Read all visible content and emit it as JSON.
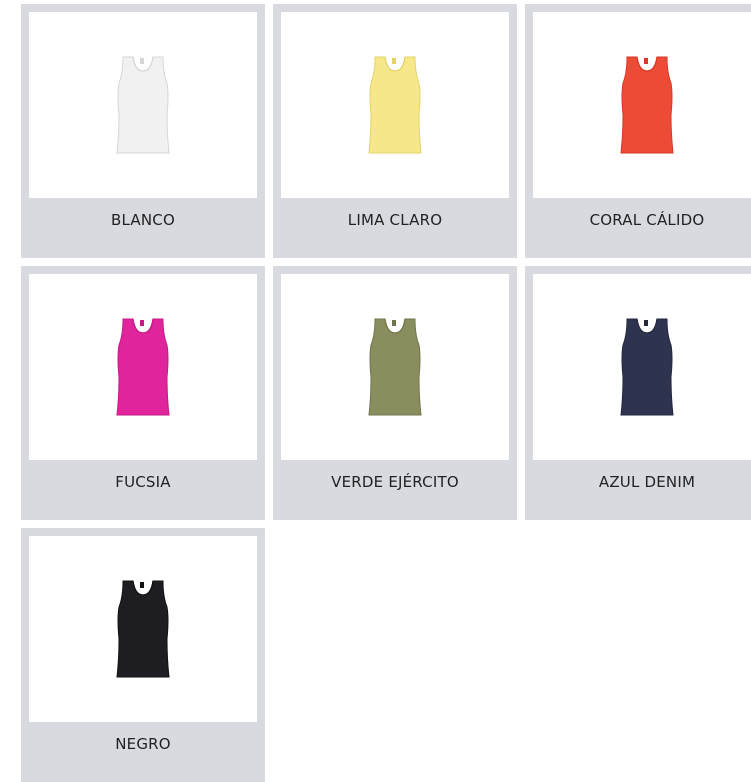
{
  "swatches": [
    {
      "label": "BLANCO",
      "color": "#f1f1f1",
      "outline": "#d6d6d6"
    },
    {
      "label": "LIMA CLARO",
      "color": "#f6e88a",
      "outline": "#e3d36a"
    },
    {
      "label": "CORAL CÁLIDO",
      "color": "#ee4b36",
      "outline": "#d43a26"
    },
    {
      "label": "FUCSIA",
      "color": "#e0259c",
      "outline": "#c31a86"
    },
    {
      "label": "VERDE EJÉRCITO",
      "color": "#8a8d5e",
      "outline": "#72754c"
    },
    {
      "label": "AZUL DENIM",
      "color": "#2e3450",
      "outline": "#23283f"
    },
    {
      "label": "NEGRO",
      "color": "#1e1e22",
      "outline": "#111114"
    }
  ]
}
